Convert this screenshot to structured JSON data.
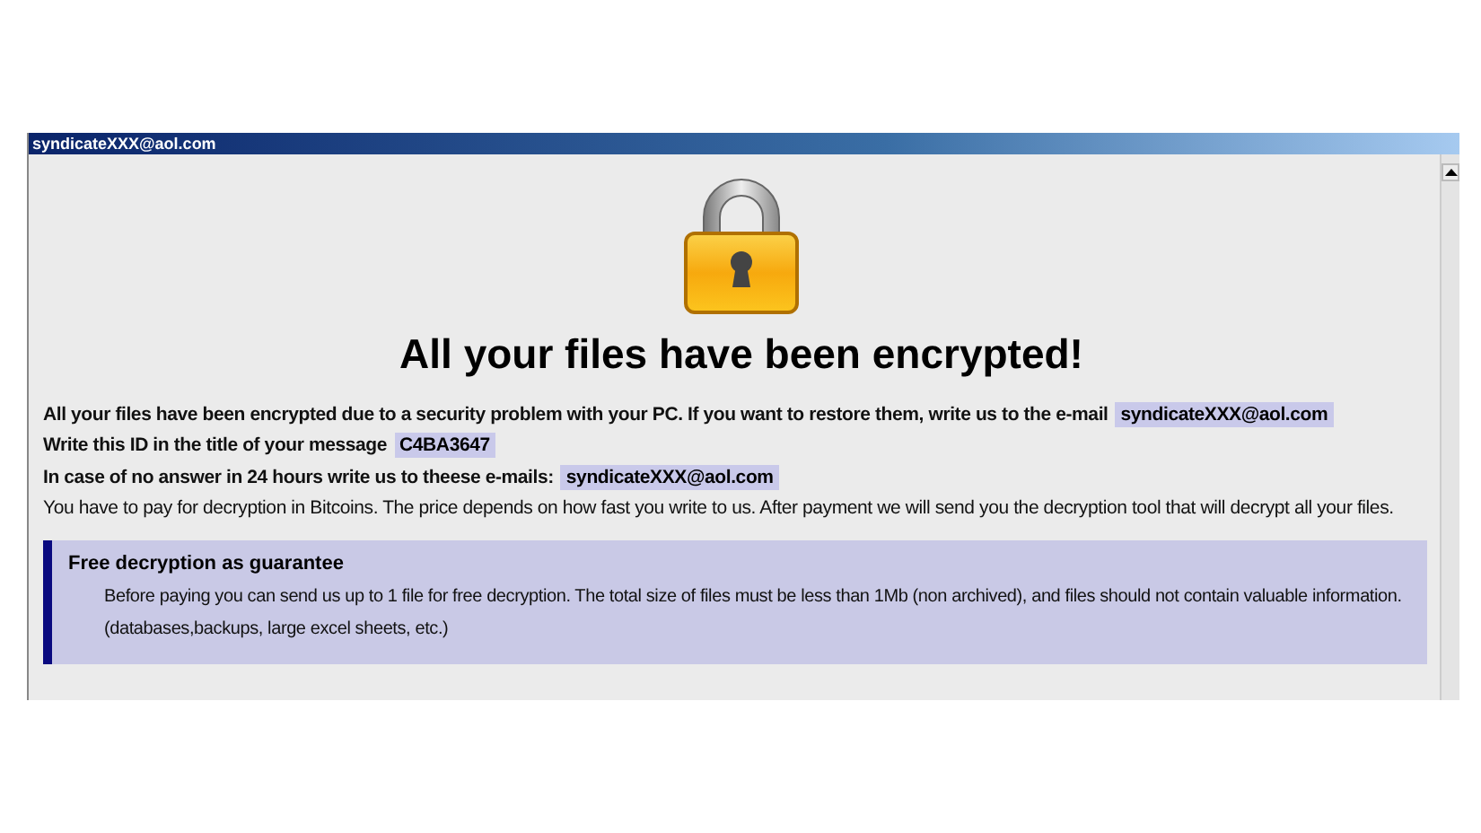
{
  "window": {
    "title": "syndicateXXX@aol.com"
  },
  "heading": "All your files have been encrypted!",
  "lines": [
    {
      "kind": "bold",
      "text": "All your files have been encrypted due to a security problem with your PC. If you want to restore them, write us to the e-mail",
      "highlight": "syndicateXXX@aol.com"
    },
    {
      "kind": "bold",
      "text": "Write this ID in the title of your message",
      "highlight": "C4BA3647"
    },
    {
      "kind": "bold",
      "text": "In case of no answer in 24 hours write us to theese e-mails:",
      "highlight": "syndicateXXX@aol.com"
    },
    {
      "kind": "plain",
      "text": "You have to pay for decryption in Bitcoins. The price depends on how fast you write to us. After payment we will send you the decryption tool that will decrypt all your files."
    }
  ],
  "guarantee": {
    "title": "Free decryption as guarantee",
    "text": "Before paying you can send us up to 1 file for free decryption. The total size of files must be less than 1Mb (non archived), and files should not contain valuable information. (databases,backups, large excel sheets, etc.)"
  }
}
